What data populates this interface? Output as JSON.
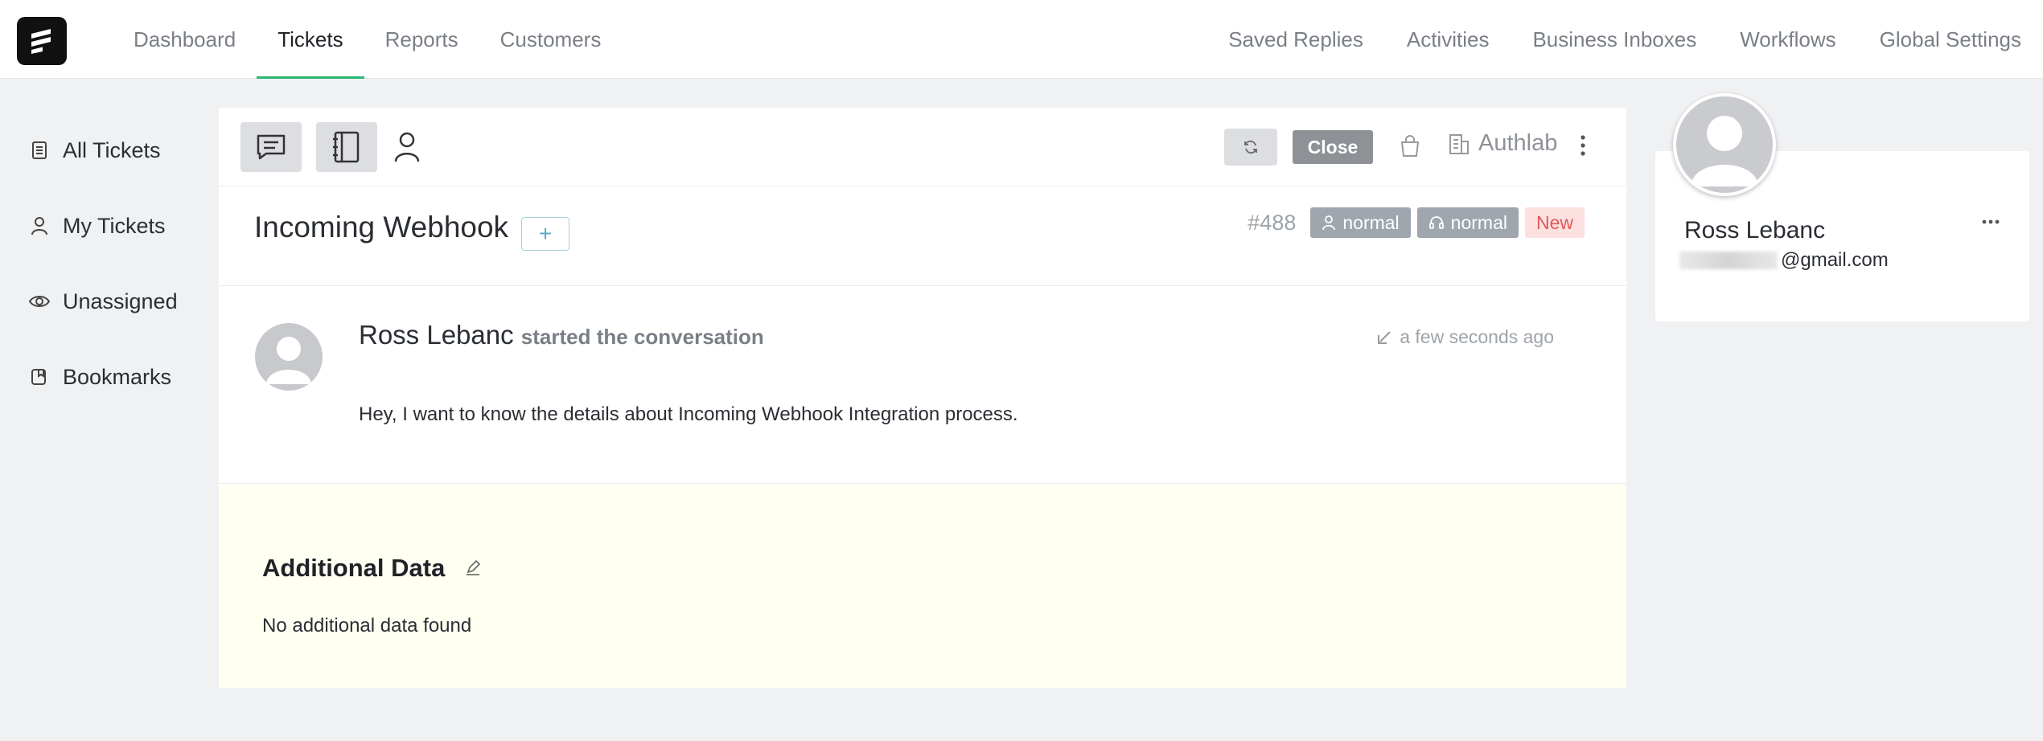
{
  "nav": {
    "left": [
      {
        "label": "Dashboard",
        "active": false
      },
      {
        "label": "Tickets",
        "active": true
      },
      {
        "label": "Reports",
        "active": false
      },
      {
        "label": "Customers",
        "active": false
      }
    ],
    "right": [
      "Saved Replies",
      "Activities",
      "Business Inboxes",
      "Workflows",
      "Global Settings"
    ],
    "accent_color": "#2bb673"
  },
  "sidebar": {
    "items": [
      {
        "label": "All Tickets",
        "icon": "list-document-icon"
      },
      {
        "label": "My Tickets",
        "icon": "user-icon"
      },
      {
        "label": "Unassigned",
        "icon": "eye-icon"
      },
      {
        "label": "Bookmarks",
        "icon": "bookmark-icon"
      }
    ]
  },
  "toolbar": {
    "close_label": "Close",
    "company": "Authlab"
  },
  "ticket": {
    "title": "Incoming Webhook",
    "add_label": "+",
    "id": "#488",
    "priority_customer": "normal",
    "priority_agent": "normal",
    "status": "New"
  },
  "conversation": {
    "author": "Ross Lebanc",
    "action": "started the conversation",
    "time": "a few seconds ago",
    "message": "Hey, I want to know the details about Incoming Webhook Integration process."
  },
  "additional": {
    "title": "Additional Data",
    "empty": "No additional data found"
  },
  "customer": {
    "name": "Ross Lebanc",
    "email_suffix": "@gmail.com"
  }
}
